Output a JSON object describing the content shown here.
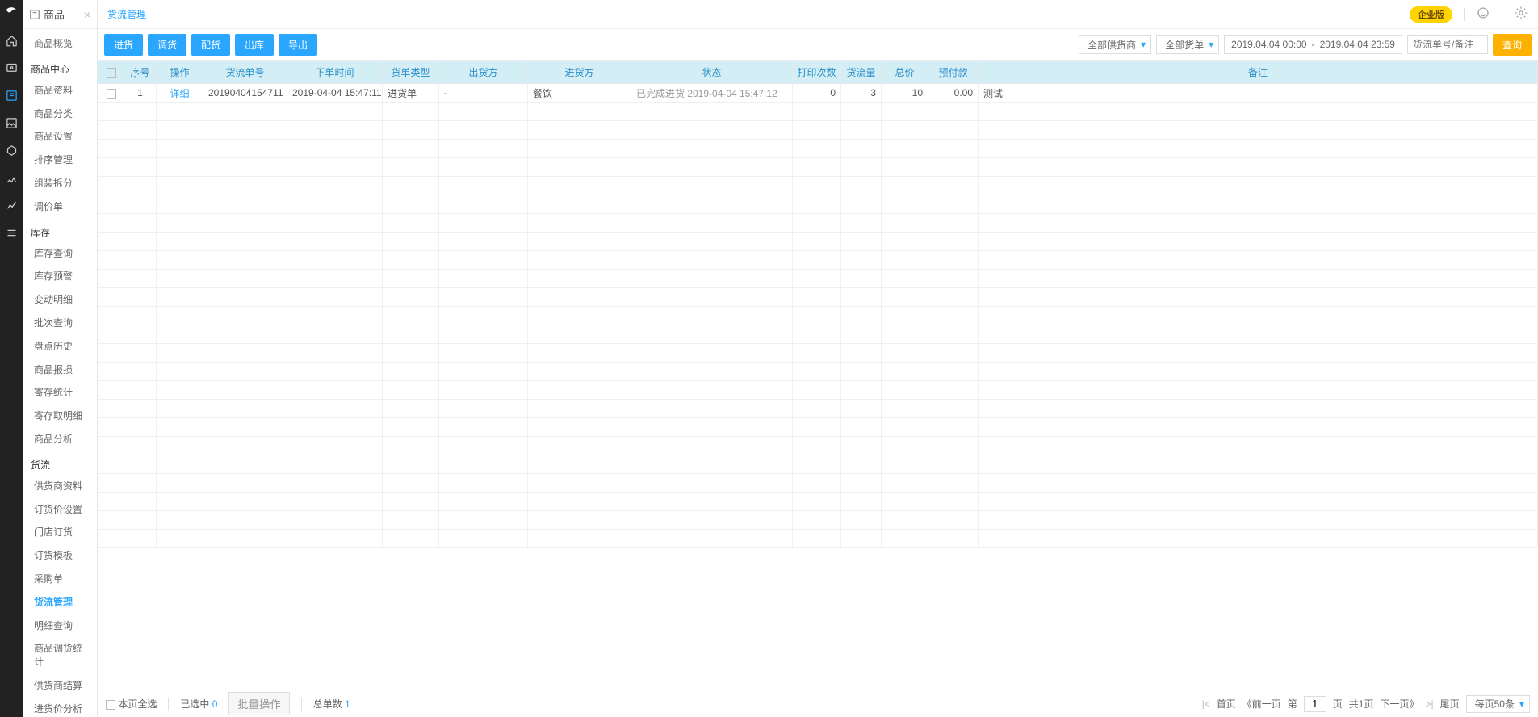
{
  "side": {
    "title": "商品",
    "sections": [
      {
        "kind": "item",
        "label": "商品概览"
      },
      {
        "kind": "group",
        "label": "商品中心"
      },
      {
        "kind": "item",
        "label": "商品资料"
      },
      {
        "kind": "item",
        "label": "商品分类"
      },
      {
        "kind": "item",
        "label": "商品设置"
      },
      {
        "kind": "item",
        "label": "排序管理"
      },
      {
        "kind": "item",
        "label": "组装拆分"
      },
      {
        "kind": "item",
        "label": "调价单"
      },
      {
        "kind": "group",
        "label": "库存"
      },
      {
        "kind": "item",
        "label": "库存查询"
      },
      {
        "kind": "item",
        "label": "库存预警"
      },
      {
        "kind": "item",
        "label": "变动明细"
      },
      {
        "kind": "item",
        "label": "批次查询"
      },
      {
        "kind": "item",
        "label": "盘点历史"
      },
      {
        "kind": "item",
        "label": "商品报损"
      },
      {
        "kind": "item",
        "label": "寄存统计"
      },
      {
        "kind": "item",
        "label": "寄存取明细"
      },
      {
        "kind": "item",
        "label": "商品分析"
      },
      {
        "kind": "group",
        "label": "货流"
      },
      {
        "kind": "item",
        "label": "供货商资料"
      },
      {
        "kind": "item",
        "label": "订货价设置"
      },
      {
        "kind": "item",
        "label": "门店订货"
      },
      {
        "kind": "item",
        "label": "订货模板"
      },
      {
        "kind": "item",
        "label": "采购单"
      },
      {
        "kind": "item",
        "label": "货流管理",
        "active": true
      },
      {
        "kind": "item",
        "label": "明细查询"
      },
      {
        "kind": "item",
        "label": "商品调货统计"
      },
      {
        "kind": "item",
        "label": "供货商结算"
      },
      {
        "kind": "item",
        "label": "进货价分析"
      }
    ]
  },
  "top": {
    "crumb": "货流管理",
    "badge": "企业版"
  },
  "toolbar": {
    "btns": [
      "进货",
      "调货",
      "配货",
      "出库",
      "导出"
    ],
    "supplier": "全部供货商",
    "ordertype": "全部货单",
    "date_from": "2019.04.04 00:00",
    "date_to": "2019.04.04 23:59",
    "date_sep": "-",
    "search_ph": "货流单号/备注",
    "query": "查询"
  },
  "table": {
    "headers": [
      "",
      "序号",
      "操作",
      "货流单号",
      "下单时间",
      "货单类型",
      "出货方",
      "进货方",
      "状态",
      "打印次数",
      "货流量",
      "总价",
      "预付款",
      "备注"
    ],
    "row": {
      "index": "1",
      "op": "详细",
      "orderno": "20190404154711",
      "time": "2019-04-04 15:47:11",
      "type": "进货单",
      "out": "-",
      "in": "餐饮",
      "status": "已完成进货 2019-04-04 15:47:12",
      "prints": "0",
      "qty": "3",
      "total": "10",
      "prepay": "0.00",
      "remark": "测试"
    }
  },
  "footer": {
    "select_all": "本页全选",
    "selected_label": "已选中",
    "selected_count": "0",
    "batch": "批量操作",
    "total_label": "总单数",
    "total_count": "1",
    "pager": {
      "first": "首页",
      "prev_outer": "《前一页",
      "di": "第",
      "page": "1",
      "ye": "页",
      "total_pages": "共1页",
      "next": "下一页》",
      "last": "尾页",
      "pagesize": "每页50条"
    }
  }
}
